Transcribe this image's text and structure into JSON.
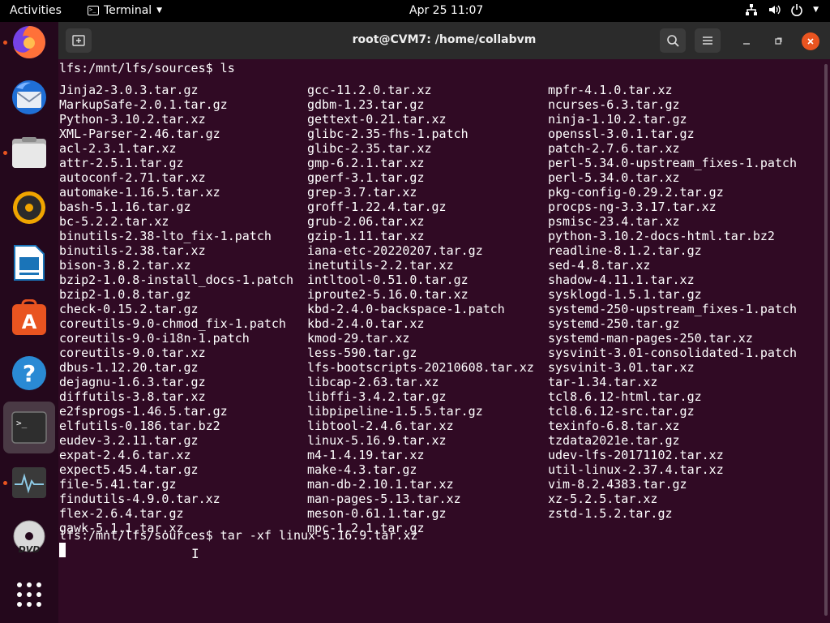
{
  "topbar": {
    "activities": "Activities",
    "app_name": "Terminal",
    "datetime": "Apr 25  11:07"
  },
  "dock": {
    "items": [
      "firefox",
      "thunderbird",
      "files",
      "rhythmbox",
      "libreoffice-impress",
      "software",
      "help",
      "terminal",
      "system-monitor",
      "dvd",
      "show-apps"
    ]
  },
  "window": {
    "title": "root@CVM7: /home/collabvm"
  },
  "terminal": {
    "prompt_ls": "lfs:/mnt/lfs/sources$ ls",
    "prompt_tar": "lfs:/mnt/lfs/sources$ tar -xf linux-5.16.9.tar.xz",
    "columns": [
      [
        "Jinja2-3.0.3.tar.gz",
        "MarkupSafe-2.0.1.tar.gz",
        "Python-3.10.2.tar.xz",
        "XML-Parser-2.46.tar.gz",
        "acl-2.3.1.tar.xz",
        "attr-2.5.1.tar.gz",
        "autoconf-2.71.tar.xz",
        "automake-1.16.5.tar.xz",
        "bash-5.1.16.tar.gz",
        "bc-5.2.2.tar.xz",
        "binutils-2.38-lto_fix-1.patch",
        "binutils-2.38.tar.xz",
        "bison-3.8.2.tar.xz",
        "bzip2-1.0.8-install_docs-1.patch",
        "bzip2-1.0.8.tar.gz",
        "check-0.15.2.tar.gz",
        "coreutils-9.0-chmod_fix-1.patch",
        "coreutils-9.0-i18n-1.patch",
        "coreutils-9.0.tar.xz",
        "dbus-1.12.20.tar.gz",
        "dejagnu-1.6.3.tar.gz",
        "diffutils-3.8.tar.xz",
        "e2fsprogs-1.46.5.tar.gz",
        "elfutils-0.186.tar.bz2",
        "eudev-3.2.11.tar.gz",
        "expat-2.4.6.tar.xz",
        "expect5.45.4.tar.gz",
        "file-5.41.tar.gz",
        "findutils-4.9.0.tar.xz",
        "flex-2.6.4.tar.gz",
        "gawk-5.1.1.tar.xz"
      ],
      [
        "gcc-11.2.0.tar.xz",
        "gdbm-1.23.tar.gz",
        "gettext-0.21.tar.xz",
        "glibc-2.35-fhs-1.patch",
        "glibc-2.35.tar.xz",
        "gmp-6.2.1.tar.xz",
        "gperf-3.1.tar.gz",
        "grep-3.7.tar.xz",
        "groff-1.22.4.tar.gz",
        "grub-2.06.tar.xz",
        "gzip-1.11.tar.xz",
        "iana-etc-20220207.tar.gz",
        "inetutils-2.2.tar.xz",
        "intltool-0.51.0.tar.gz",
        "iproute2-5.16.0.tar.xz",
        "kbd-2.4.0-backspace-1.patch",
        "kbd-2.4.0.tar.xz",
        "kmod-29.tar.xz",
        "less-590.tar.gz",
        "lfs-bootscripts-20210608.tar.xz",
        "libcap-2.63.tar.xz",
        "libffi-3.4.2.tar.gz",
        "libpipeline-1.5.5.tar.gz",
        "libtool-2.4.6.tar.xz",
        "linux-5.16.9.tar.xz",
        "m4-1.4.19.tar.xz",
        "make-4.3.tar.gz",
        "man-db-2.10.1.tar.xz",
        "man-pages-5.13.tar.xz",
        "meson-0.61.1.tar.gz",
        "mpc-1.2.1.tar.gz"
      ],
      [
        "mpfr-4.1.0.tar.xz",
        "ncurses-6.3.tar.gz",
        "ninja-1.10.2.tar.gz",
        "openssl-3.0.1.tar.gz",
        "patch-2.7.6.tar.xz",
        "perl-5.34.0-upstream_fixes-1.patch",
        "perl-5.34.0.tar.xz",
        "pkg-config-0.29.2.tar.gz",
        "procps-ng-3.3.17.tar.xz",
        "psmisc-23.4.tar.xz",
        "python-3.10.2-docs-html.tar.bz2",
        "readline-8.1.2.tar.gz",
        "sed-4.8.tar.xz",
        "shadow-4.11.1.tar.xz",
        "sysklogd-1.5.1.tar.gz",
        "systemd-250-upstream_fixes-1.patch",
        "systemd-250.tar.gz",
        "systemd-man-pages-250.tar.xz",
        "sysvinit-3.01-consolidated-1.patch",
        "sysvinit-3.01.tar.xz",
        "tar-1.34.tar.xz",
        "tcl8.6.12-html.tar.gz",
        "tcl8.6.12-src.tar.gz",
        "texinfo-6.8.tar.xz",
        "tzdata2021e.tar.gz",
        "udev-lfs-20171102.tar.xz",
        "util-linux-2.37.4.tar.xz",
        "vim-8.2.4383.tar.gz",
        "xz-5.2.5.tar.xz",
        "zstd-1.5.2.tar.gz"
      ]
    ]
  },
  "colors": {
    "terminal_bg": "#300a24",
    "accent": "#e95420"
  }
}
